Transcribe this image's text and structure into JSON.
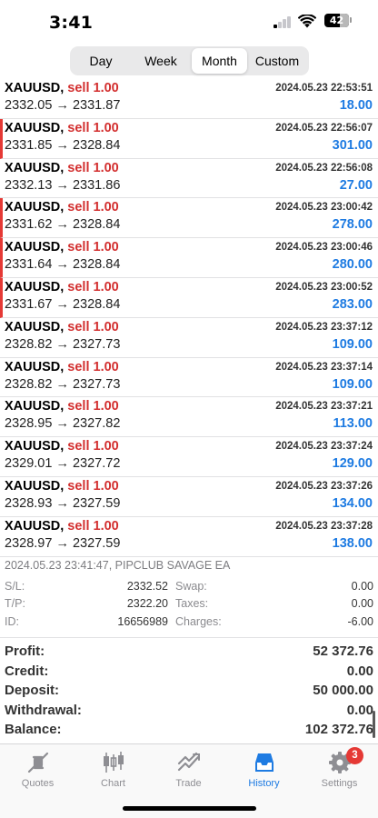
{
  "status": {
    "time": "3:41",
    "battery": "42"
  },
  "periods": {
    "items": [
      "Day",
      "Week",
      "Month",
      "Custom"
    ],
    "selected": "Month"
  },
  "deals": [
    {
      "symbol": "XAUUSD,",
      "side": "sell 1.00",
      "prices": "2332.05 → 2331.87",
      "datetime": "2024.05.23 22:53:51",
      "profit": "18.00",
      "loss_marker": false
    },
    {
      "symbol": "XAUUSD,",
      "side": "sell 1.00",
      "prices": "2331.85 → 2328.84",
      "datetime": "2024.05.23 22:56:07",
      "profit": "301.00",
      "loss_marker": true
    },
    {
      "symbol": "XAUUSD,",
      "side": "sell 1.00",
      "prices": "2332.13 → 2331.86",
      "datetime": "2024.05.23 22:56:08",
      "profit": "27.00",
      "loss_marker": false
    },
    {
      "symbol": "XAUUSD,",
      "side": "sell 1.00",
      "prices": "2331.62 → 2328.84",
      "datetime": "2024.05.23 23:00:42",
      "profit": "278.00",
      "loss_marker": true
    },
    {
      "symbol": "XAUUSD,",
      "side": "sell 1.00",
      "prices": "2331.64 → 2328.84",
      "datetime": "2024.05.23 23:00:46",
      "profit": "280.00",
      "loss_marker": true
    },
    {
      "symbol": "XAUUSD,",
      "side": "sell 1.00",
      "prices": "2331.67 → 2328.84",
      "datetime": "2024.05.23 23:00:52",
      "profit": "283.00",
      "loss_marker": true
    },
    {
      "symbol": "XAUUSD,",
      "side": "sell 1.00",
      "prices": "2328.82 → 2327.73",
      "datetime": "2024.05.23 23:37:12",
      "profit": "109.00",
      "loss_marker": false
    },
    {
      "symbol": "XAUUSD,",
      "side": "sell 1.00",
      "prices": "2328.82 → 2327.73",
      "datetime": "2024.05.23 23:37:14",
      "profit": "109.00",
      "loss_marker": false
    },
    {
      "symbol": "XAUUSD,",
      "side": "sell 1.00",
      "prices": "2328.95 → 2327.82",
      "datetime": "2024.05.23 23:37:21",
      "profit": "113.00",
      "loss_marker": false
    },
    {
      "symbol": "XAUUSD,",
      "side": "sell 1.00",
      "prices": "2329.01 → 2327.72",
      "datetime": "2024.05.23 23:37:24",
      "profit": "129.00",
      "loss_marker": false
    },
    {
      "symbol": "XAUUSD,",
      "side": "sell 1.00",
      "prices": "2328.93 → 2327.59",
      "datetime": "2024.05.23 23:37:26",
      "profit": "134.00",
      "loss_marker": false
    },
    {
      "symbol": "XAUUSD,",
      "side": "sell 1.00",
      "prices": "2328.97 → 2327.59",
      "datetime": "2024.05.23 23:37:28",
      "profit": "138.00",
      "loss_marker": false
    }
  ],
  "detail": {
    "info": "2024.05.23 23:41:47, PIPCLUB SAVAGE EA",
    "sl_label": "S/L:",
    "sl": "2332.52",
    "tp_label": "T/P:",
    "tp": "2322.20",
    "id_label": "ID:",
    "id": "16656989",
    "swap_label": "Swap:",
    "swap": "0.00",
    "taxes_label": "Taxes:",
    "taxes": "0.00",
    "charges_label": "Charges:",
    "charges": "-6.00"
  },
  "summary": [
    {
      "label": "Profit:",
      "value": "52 372.76"
    },
    {
      "label": "Credit:",
      "value": "0.00"
    },
    {
      "label": "Deposit:",
      "value": "50 000.00"
    },
    {
      "label": "Withdrawal:",
      "value": "0.00"
    },
    {
      "label": "Balance:",
      "value": "102 372.76"
    }
  ],
  "tabs": [
    {
      "label": "Quotes",
      "icon": "quotes-icon"
    },
    {
      "label": "Chart",
      "icon": "chart-icon"
    },
    {
      "label": "Trade",
      "icon": "trade-icon"
    },
    {
      "label": "History",
      "icon": "history-icon"
    },
    {
      "label": "Settings",
      "icon": "settings-icon"
    }
  ],
  "settings_badge": "3",
  "colors": {
    "accent": "#1e7be2",
    "sell": "#d32f2f",
    "marker": "#e53935"
  }
}
